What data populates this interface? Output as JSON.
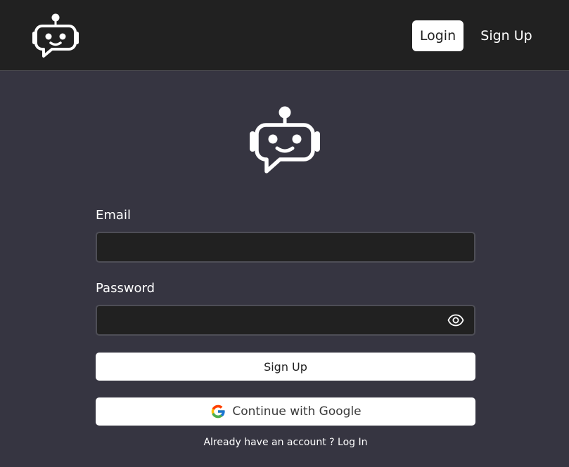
{
  "header": {
    "login_label": "Login",
    "signup_label": "Sign Up"
  },
  "form": {
    "email_label": "Email",
    "email_value": "",
    "password_label": "Password",
    "password_value": "",
    "signup_button": "Sign Up",
    "google_button": "Continue with Google",
    "footer_prefix": "Already have an account ? ",
    "footer_link": "Log In"
  },
  "icons": {
    "logo": "robot-chat-icon",
    "password_toggle": "eye-icon",
    "google": "google-icon"
  },
  "colors": {
    "header_bg": "#212121",
    "page_bg": "#363541",
    "input_bg": "#212121",
    "button_bg": "#ffffff"
  }
}
